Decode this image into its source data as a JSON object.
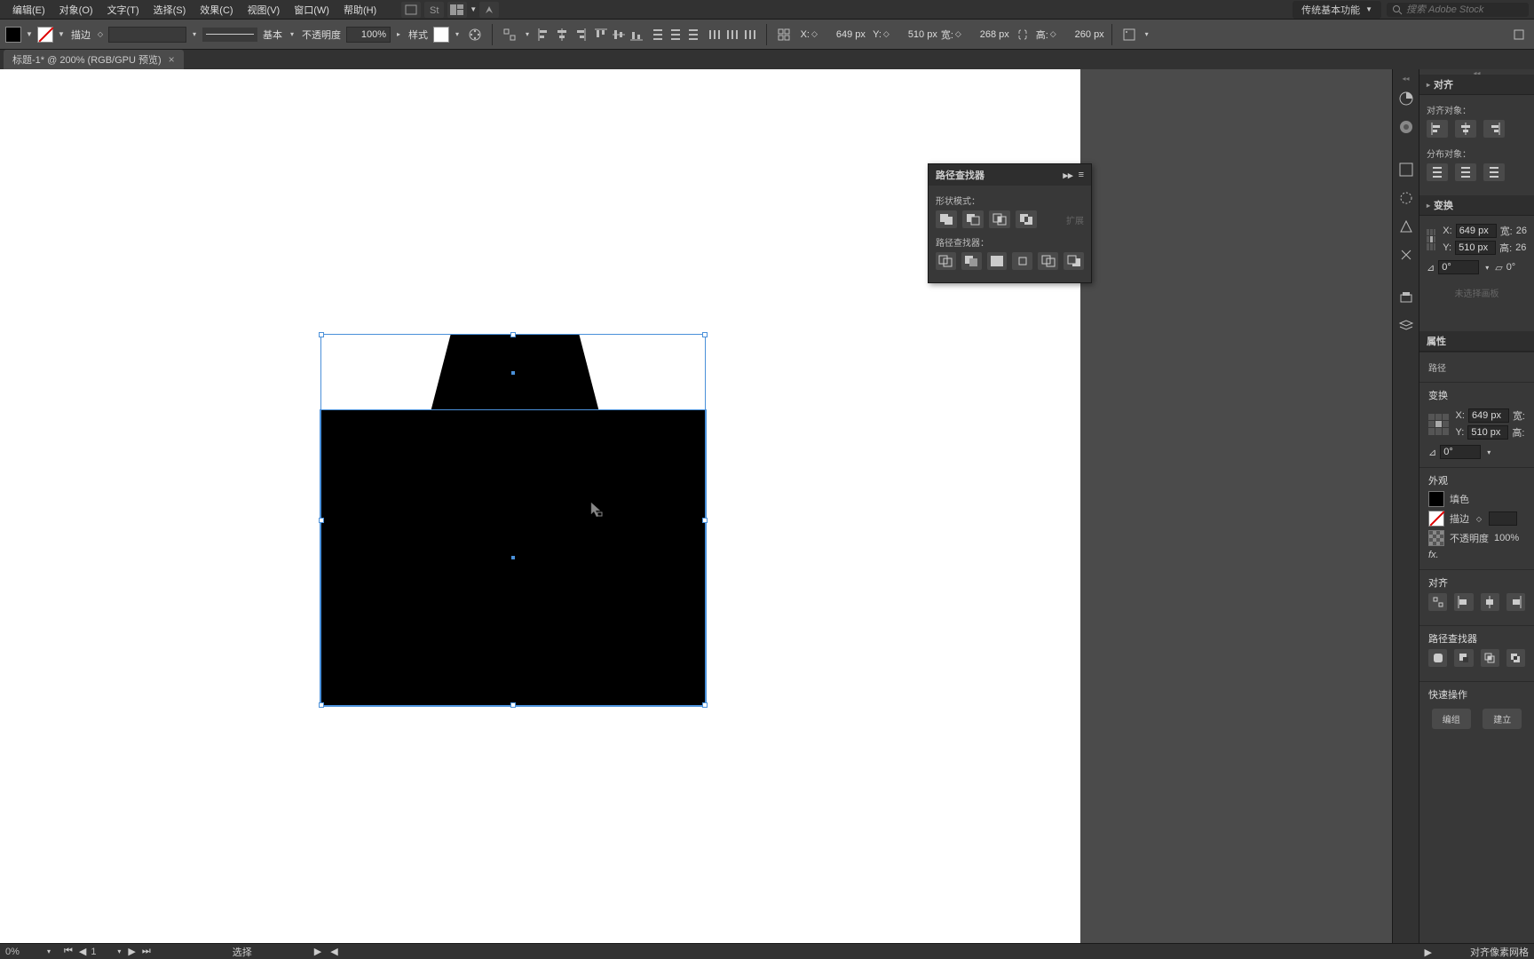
{
  "menu": {
    "edit": "编辑(E)",
    "object": "对象(O)",
    "text": "文字(T)",
    "select": "选择(S)",
    "effect": "效果(C)",
    "view": "视图(V)",
    "window": "窗口(W)",
    "help": "帮助(H)"
  },
  "workspace": "传统基本功能",
  "search_placeholder": "搜索 Adobe Stock",
  "options": {
    "stroke_label": "描边",
    "stroke_weight": "",
    "stroke_profile": "基本",
    "opacity_label": "不透明度",
    "opacity": "100%",
    "style_label": "样式",
    "x_label": "X:",
    "x_val": "649 px",
    "y_label": "Y:",
    "y_val": "510 px",
    "w_label": "宽:",
    "w_val": "268 px",
    "h_label": "高:",
    "h_val": "260 px"
  },
  "tab": {
    "title": "标题-1* @ 200% (RGB/GPU 预览)",
    "close": "×"
  },
  "pathfinder": {
    "title": "路径查找器",
    "shape_modes": "形状模式：",
    "pathfinders": "路径查找器：",
    "expand": "扩展"
  },
  "panels": {
    "align_title": "对齐",
    "align_objects": "对齐对象：",
    "distribute_objects": "分布对象：",
    "transform_title": "变换",
    "transform_x": "649 px",
    "transform_y": "510 px",
    "transform_w": "26",
    "transform_h": "26",
    "transform_angle": "0°",
    "transform_shear": "0°",
    "w_label": "宽:",
    "h_label": "高:",
    "no_selection": "未选择画板"
  },
  "properties": {
    "title": "属性",
    "path": "路径",
    "transform": "变换",
    "x": "649 px",
    "y": "510 px",
    "angle": "0°",
    "appearance": "外观",
    "fill": "填色",
    "stroke": "描边",
    "stroke_weight": "",
    "opacity_label": "不透明度",
    "opacity": "100%",
    "align": "对齐",
    "pathfinder": "路径查找器",
    "quick_actions": "快速操作",
    "group": "编组",
    "arrange": "建立"
  },
  "status": {
    "zoom": "0%",
    "artboard": "1",
    "tool": "选择",
    "pixel_snap": "对齐像素网格"
  }
}
